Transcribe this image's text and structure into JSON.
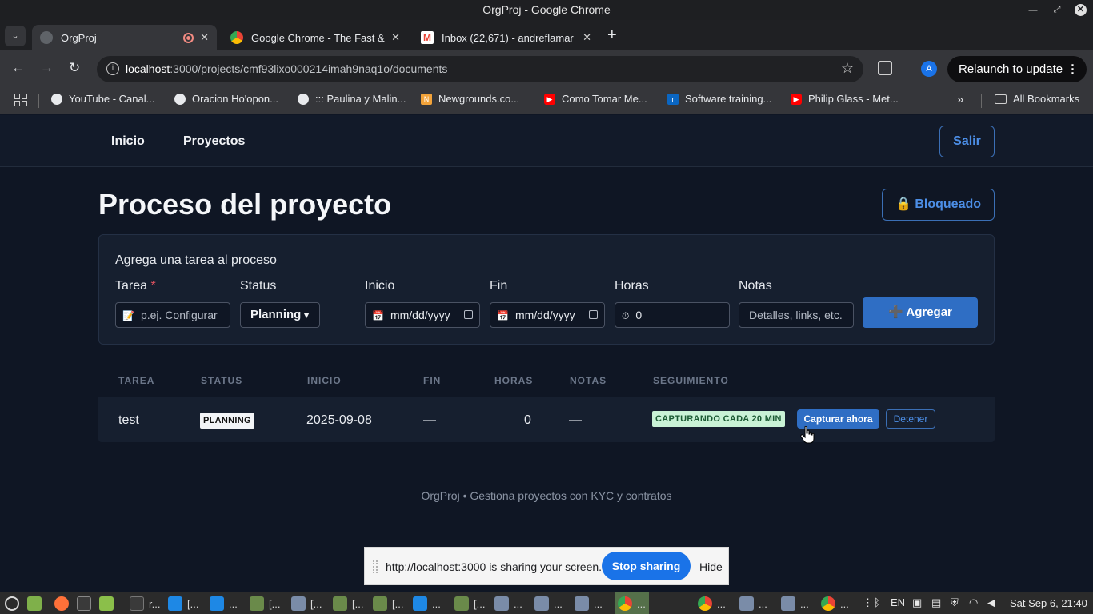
{
  "window": {
    "title": "OrgProj - Google Chrome"
  },
  "tabs": [
    {
      "label": "OrgProj",
      "active": true,
      "recording": true
    },
    {
      "label": "Google Chrome - The Fast &",
      "active": false
    },
    {
      "label": "Inbox (22,671) - andreflamar",
      "active": false
    }
  ],
  "toolbar": {
    "url_host": "localhost",
    "url_path": ":3000/projects/cmf93lixo000214imah9naq1o/documents",
    "avatar_letter": "A",
    "relaunch_label": "Relaunch to update"
  },
  "bookmarks": {
    "items": [
      {
        "label": "YouTube - Canal...",
        "icon": "globe-icon"
      },
      {
        "label": "Oracion Ho'opon...",
        "icon": "globe-icon"
      },
      {
        "label": "::: Paulina y Malin...",
        "icon": "globe-icon"
      },
      {
        "label": "Newgrounds.co...",
        "icon": "newgrounds-icon"
      },
      {
        "label": "Como Tomar Me...",
        "icon": "youtube-icon"
      },
      {
        "label": "Software training...",
        "icon": "linkedin-icon"
      },
      {
        "label": "Philip Glass - Met...",
        "icon": "youtube-icon"
      }
    ],
    "more": "»",
    "all_bookmarks": "All Bookmarks"
  },
  "app": {
    "nav": {
      "home": "Inicio",
      "projects": "Proyectos",
      "logout": "Salir"
    },
    "page_title": "Proceso del proyecto",
    "lock_button": "🔒 Bloqueado",
    "form": {
      "title": "Agrega una tarea al proceso",
      "task_label": "Tarea",
      "required_mark": "*",
      "task_placeholder": "p.ej. Configurar",
      "status_label": "Status",
      "status_value": "Planning",
      "start_label": "Inicio",
      "start_value": "mm/dd/yyyy",
      "end_label": "Fin",
      "end_value": "mm/dd/yyyy",
      "hours_label": "Horas",
      "hours_value": "0",
      "notes_label": "Notas",
      "notes_placeholder": "Detalles, links, etc.",
      "add_button": "➕ Agregar"
    },
    "table": {
      "headers": [
        "TAREA",
        "STATUS",
        "INICIO",
        "FIN",
        "HORAS",
        "NOTAS",
        "SEGUIMIENTO"
      ],
      "rows": [
        {
          "task": "test",
          "status": "PLANNING",
          "start": "2025-09-08",
          "end": "—",
          "hours": "0",
          "notes": "—",
          "tracking": "CAPTURANDO CADA 20 MIN",
          "capture_button": "Capturar ahora",
          "stop_button": "Detener"
        }
      ]
    },
    "footer": "OrgProj • Gestiona proyectos con KYC y contratos"
  },
  "share_bar": {
    "text": "http://localhost:3000 is sharing your screen.",
    "stop": "Stop sharing",
    "hide": "Hide"
  },
  "taskbar": {
    "items": [
      {
        "label": "r...",
        "icon": "terminal-icon"
      },
      {
        "label": "[...",
        "icon": "vscode-icon"
      },
      {
        "label": "...",
        "icon": "vscode-icon"
      },
      {
        "label": "[...",
        "icon": "archive-icon"
      },
      {
        "label": "[...",
        "icon": "camera-icon"
      },
      {
        "label": "[...",
        "icon": "terminal-icon"
      },
      {
        "label": "[...",
        "icon": "terminal-icon"
      },
      {
        "label": "...",
        "icon": "vscode-icon"
      },
      {
        "label": "[...",
        "icon": "archive-icon"
      },
      {
        "label": "...",
        "icon": "camera-icon"
      },
      {
        "label": "...",
        "icon": "camera-icon"
      },
      {
        "label": "...",
        "icon": "camera-icon"
      },
      {
        "label": "...",
        "icon": "chrome-icon"
      },
      {
        "label": "...",
        "icon": "chrome-icon"
      },
      {
        "label": "...",
        "icon": "camera-icon"
      },
      {
        "label": "...",
        "icon": "camera-icon"
      },
      {
        "label": "...",
        "icon": "chrome-icon"
      }
    ],
    "keyboard_layout": "EN",
    "clock": "Sat Sep  6, 21:40"
  },
  "colors": {
    "accent": "#2f6ec4",
    "page_bg": "#0f1624",
    "success_badge": "#c9f2d6"
  }
}
